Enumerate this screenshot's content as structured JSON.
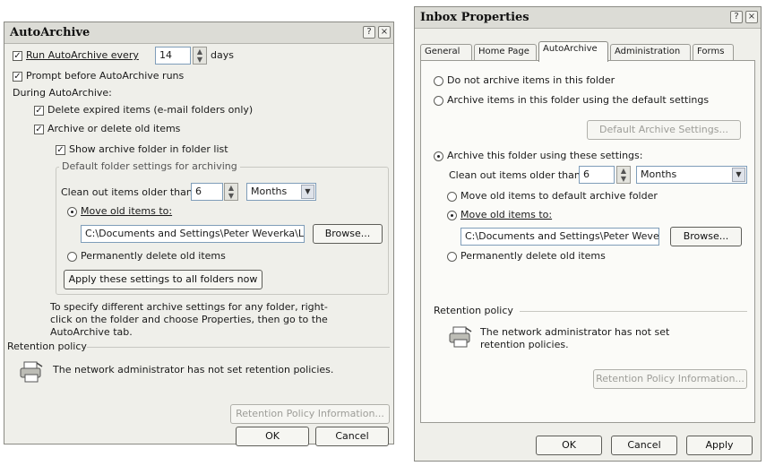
{
  "autoarchive_dialog": {
    "title": "AutoArchive",
    "title_buttons": [
      "?",
      "×"
    ],
    "run_every_label": "Run AutoArchive every",
    "run_every_value": "14",
    "days_label": "days",
    "prompt_label": "Prompt before AutoArchive runs",
    "during_label": "During AutoArchive:",
    "delete_expired_label": "Delete expired items (e-mail folders only)",
    "archive_old_label": "Archive or delete old items",
    "show_folder_label": "Show archive folder in folder list",
    "defaults_group_label": "Default folder settings for archiving",
    "clean_out_label": "Clean out items older than",
    "clean_out_value": "6",
    "period_value": "Months",
    "move_label": "Move old items to:",
    "path_value": "C:\\Documents and Settings\\Peter Weverka\\Lo",
    "browse_label": "Browse...",
    "perm_delete_label": "Permanently delete old items",
    "apply_all_label": "Apply these settings to all folders now",
    "info_text": "To specify different archive settings for any folder, right-click on the folder and choose Properties, then go to the AutoArchive tab.",
    "retention_label": "Retention policy",
    "retention_text": "The network administrator has not set retention policies.",
    "retention_button": "Retention Policy Information...",
    "ok_label": "OK",
    "cancel_label": "Cancel"
  },
  "inbox_dialog": {
    "title": "Inbox Properties",
    "title_buttons": [
      "?",
      "×"
    ],
    "tabs": [
      "General",
      "Home Page",
      "AutoArchive",
      "Administration",
      "Forms"
    ],
    "active_tab": "AutoArchive",
    "no_archive_label": "Do not archive items in this folder",
    "default_archive_label": "Archive items in this folder using the default settings",
    "default_settings_button": "Default Archive Settings...",
    "custom_archive_label": "Archive this folder using these settings:",
    "clean_out_label": "Clean out items older than",
    "clean_out_value": "6",
    "period_value": "Months",
    "move_default_label": "Move old items to default archive folder",
    "move_label": "Move old items to:",
    "path_value": "C:\\Documents and Settings\\Peter Weve",
    "browse_label": "Browse...",
    "perm_delete_label": "Permanently delete old items",
    "retention_label": "Retention policy",
    "retention_text": "The network administrator has not set retention policies.",
    "retention_button": "Retention Policy Information...",
    "ok_label": "OK",
    "cancel_label": "Cancel",
    "apply_label": "Apply"
  }
}
